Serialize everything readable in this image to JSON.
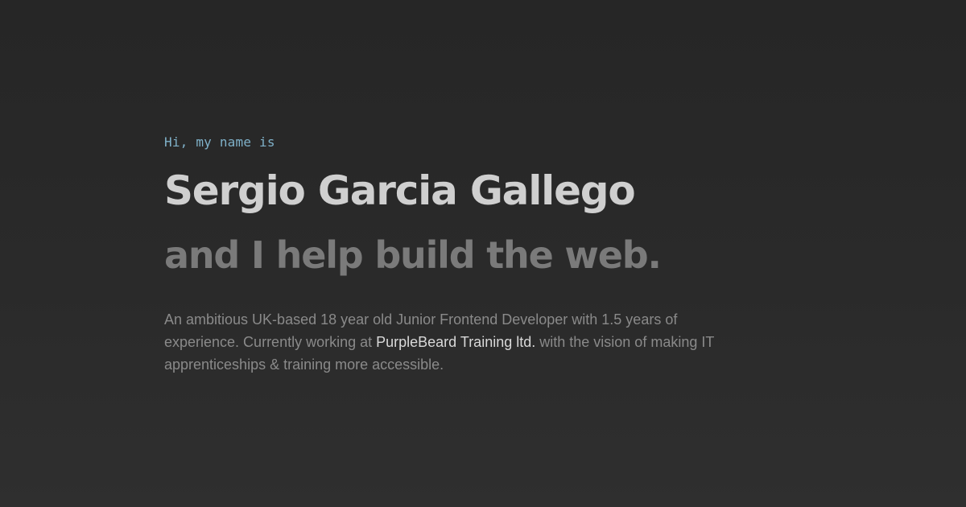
{
  "hero": {
    "greeting": "Hi, my name is",
    "name": "Sergio Garcia Gallego",
    "tagline": "and I help build the web.",
    "bio": {
      "before": "An ambitious UK-based 18 year old Junior Frontend Developer with 1.5 years of experience. Currently working at ",
      "company": "PurpleBeard Training ltd.",
      "after": " with the vision of making IT apprenticeships & training more accessible."
    }
  },
  "colors": {
    "background": "#282828",
    "greeting": "#7fb1c9",
    "name": "#cfcfcf",
    "tagline": "#7a7a7a",
    "bio": "#8a8a8a",
    "company": "#d9d9d9"
  }
}
